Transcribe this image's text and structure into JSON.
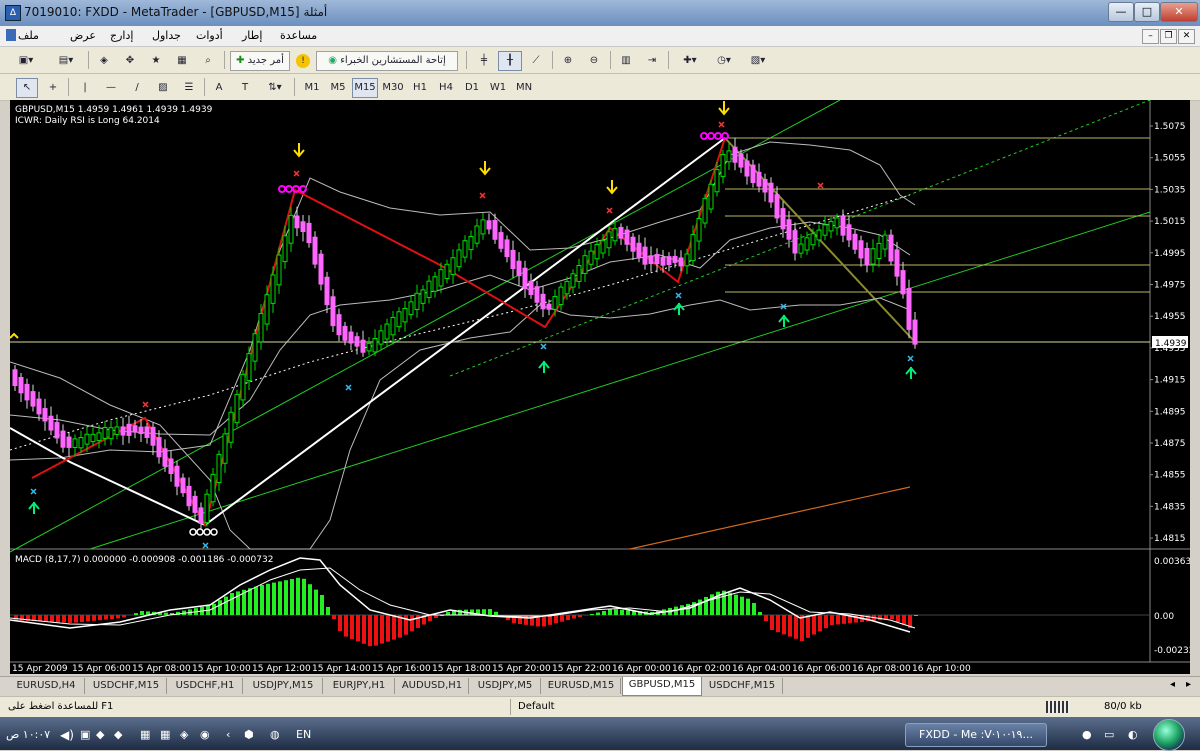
{
  "window": {
    "title": "7019010: FXDD - MetaTrader - [GBPUSD,M15] أمثلة"
  },
  "menu": {
    "items": [
      "ملف",
      "عرض",
      "إدارج",
      "جداول",
      "أدوات",
      "إطار",
      "مساعدة"
    ]
  },
  "toolbar1": {
    "new_order_label": "أمر جديد",
    "expert_label": "إتاحة المستشارين الخبراء"
  },
  "timeframes": [
    "M1",
    "M5",
    "M15",
    "M30",
    "H1",
    "H4",
    "D1",
    "W1",
    "MN"
  ],
  "active_timeframe": "M15",
  "chart": {
    "header_line1": "GBPUSD,M15  1.4959 1.4961 1.4939 1.4939",
    "header_line2": "ICWR: Daily RSI is Long 64.2014",
    "current_price": "1.4939",
    "price_labels": [
      "1.5075",
      "1.5055",
      "1.5035",
      "1.5015",
      "1.4995",
      "1.4975",
      "1.4955",
      "1.4935",
      "1.4915",
      "1.4895",
      "1.4875",
      "1.4855",
      "1.4835",
      "1.4815"
    ],
    "time_labels": [
      "15 Apr 2009",
      "15 Apr 06:00",
      "15 Apr 08:00",
      "15 Apr 10:00",
      "15 Apr 12:00",
      "15 Apr 14:00",
      "15 Apr 16:00",
      "15 Apr 18:00",
      "15 Apr 20:00",
      "15 Apr 22:00",
      "16 Apr 00:00",
      "16 Apr 02:00",
      "16 Apr 04:00",
      "16 Apr 06:00",
      "16 Apr 08:00",
      "16 Apr 10:00"
    ],
    "colors": {
      "background": "#000000",
      "bull": "#00dd00",
      "bear": "#ff66ff",
      "channel": "#22cc22",
      "zigzag_red": "#dd1111",
      "zigzag_white": "#ffffff",
      "fib": "#b8b860"
    }
  },
  "macd": {
    "label": "MACD (8,17,7) 0.000000 -0.000908 -0.001186 -0.000732",
    "scale_labels": [
      "0.00363",
      "0.00",
      "-0.00232"
    ]
  },
  "tabs": [
    "EURUSD,H4",
    "USDCHF,M15",
    "USDCHF,H1",
    "USDJPY,M15",
    "EURJPY,H1",
    "AUDUSD,H1",
    "USDJPY,M5",
    "EURUSD,M15",
    "GBPUSD,M15",
    "USDCHF,M15"
  ],
  "active_tab": "GBPUSD,M15",
  "status": {
    "help": "للمساعدة اضغط على F1",
    "profile": "Default",
    "traffic": "80/0 kb"
  },
  "taskbar": {
    "task_label": "FXDD - Me :V·١٩·١٠...",
    "lang": "EN",
    "clock": "١٠:٠٧ ص"
  }
}
